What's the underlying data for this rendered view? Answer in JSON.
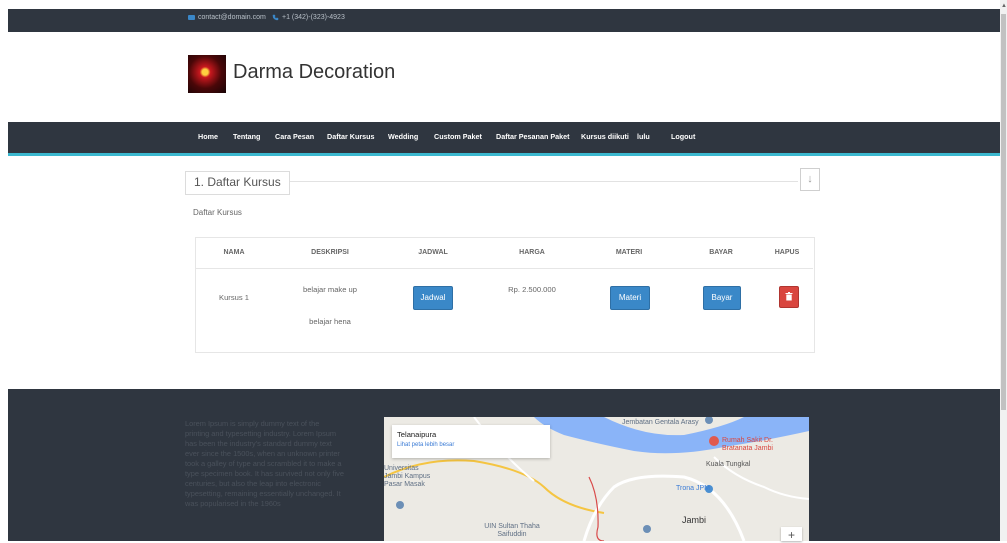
{
  "topbar": {
    "email": "contact@domain.com",
    "phone": "+1 (342)-(323)-4923",
    "email_icon": "envelope-icon",
    "phone_icon": "phone-icon"
  },
  "header": {
    "brand": "Darma Decoration"
  },
  "nav": {
    "items": [
      "Home",
      "Tentang",
      "Cara Pesan",
      "Daftar Kursus",
      "Wedding",
      "Custom Paket",
      "Daftar Pesanan Paket",
      "Kursus diikuti",
      "lulu",
      "Logout"
    ]
  },
  "section": {
    "title": "1. Daftar Kursus",
    "subtitle": "Daftar Kursus",
    "collapse_icon": "arrow-down-icon"
  },
  "table": {
    "headers": [
      "NAMA",
      "DESKRIPSI",
      "JADWAL",
      "HARGA",
      "MATERI",
      "BAYAR",
      "HAPUS"
    ],
    "rows": [
      {
        "nama": "Kursus 1",
        "deskripsi": [
          "belajar make up",
          "belajar hena"
        ],
        "jadwal_label": "Jadwal",
        "harga": "Rp. 2.500.000",
        "materi_label": "Materi",
        "bayar_label": "Bayar",
        "hapus_icon": "trash-icon"
      }
    ]
  },
  "footer": {
    "about_text": "Lorem Ipsum is simply dummy text of the printing and typesetting industry. Lorem Ipsum has been the industry's standard dummy text ever since the 1500s, when an unknown printer took a galley of type and scrambled it to make a type specimen book. It has survived not only five centuries, but also the leap into electronic typesetting, remaining essentially unchanged. It was popularised in the 1960s",
    "map": {
      "place": "Telanaipura",
      "link": "Lihat peta lebih besar",
      "labels": [
        "Jembatan Gentala Arasy",
        "Rumah Sakit Dr. Bratanata Jambi",
        "Kuala Tungkal",
        "Trona JPM",
        "Jambi",
        "UIN Sultan Thaha Saifuddin",
        "Universitas Jambi Kampus Pasar Masak"
      ],
      "zoom_in": "+"
    }
  },
  "colors": {
    "dark": "#2f3640",
    "accent": "#3bb8cf",
    "button_blue": "#3a88c8",
    "button_red": "#d9463f"
  }
}
